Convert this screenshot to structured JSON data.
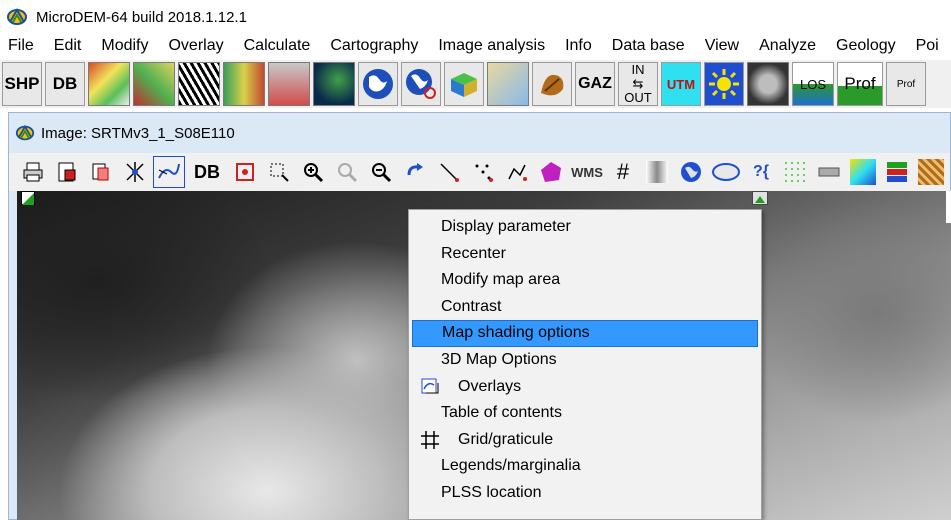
{
  "window": {
    "title": "MicroDEM-64 build 2018.1.12.1",
    "icon": "microdem-app-icon"
  },
  "menubar": {
    "items": [
      "File",
      "Edit",
      "Modify",
      "Overlay",
      "Calculate",
      "Cartography",
      "Image analysis",
      "Info",
      "Data base",
      "View",
      "Analyze",
      "Geology",
      "Poi"
    ]
  },
  "main_toolbar": {
    "shp_label": "SHP",
    "db_label": "DB",
    "gaz_label": "GAZ",
    "inout_top": "IN",
    "inout_bottom": "OUT",
    "utm_label": "UTM",
    "los_label": "LOS",
    "prof_label": "Prof",
    "prof_small_label": "Prof"
  },
  "inner_window": {
    "title": "Image: SRTMv3_1_S08E110",
    "icon": "microdem-app-icon"
  },
  "map_toolbar": {
    "db_label": "DB",
    "wms_label": "WMS",
    "info_label": "?{"
  },
  "context_menu": {
    "items": [
      {
        "label": "Display parameter",
        "icon": null,
        "highlighted": false
      },
      {
        "label": "Recenter",
        "icon": null,
        "highlighted": false
      },
      {
        "label": "Modify map area",
        "icon": null,
        "highlighted": false
      },
      {
        "label": "Contrast",
        "icon": null,
        "highlighted": false
      },
      {
        "label": "Map shading options",
        "icon": null,
        "highlighted": true
      },
      {
        "label": "3D Map Options",
        "icon": null,
        "highlighted": false
      },
      {
        "label": "Overlays",
        "icon": "overlays-icon",
        "highlighted": false
      },
      {
        "label": "Table of contents",
        "icon": null,
        "highlighted": false
      },
      {
        "label": "Grid/graticule",
        "icon": "grid-icon",
        "highlighted": false
      },
      {
        "label": "Legends/marginalia",
        "icon": null,
        "highlighted": false
      },
      {
        "label": "PLSS location",
        "icon": null,
        "highlighted": false
      }
    ]
  },
  "colors": {
    "highlight": "#3399ff",
    "menu_bg": "#f2f2f2",
    "window_frame": "#dbe8f5"
  }
}
